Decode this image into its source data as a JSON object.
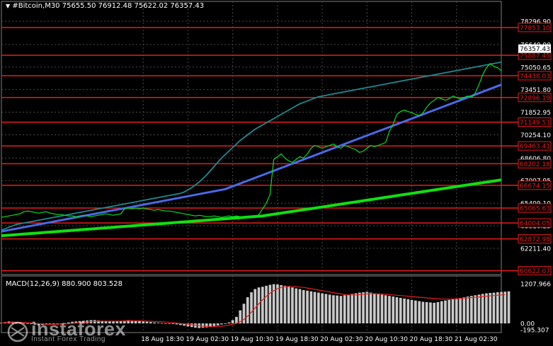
{
  "header": {
    "symbol": "#Bitcoin,M30",
    "ohlc": "75655.50 76912.48 75622.02 76357.43"
  },
  "macd_header": "MACD(12,26,9) 880.900 803.528",
  "watermark": {
    "brand": "instaforex",
    "tagline": "Instant Forex Trading"
  },
  "colors": {
    "background": "#000000",
    "grid": "#4a4a4a",
    "levels": "#e81b1b",
    "price": "#00e020",
    "ma_fast": "#1f8a8e",
    "ma_mid": "#4a6ae8",
    "ma_slow": "#10e010",
    "macd_hist": "#c8c8c8",
    "macd_signal": "#e02020"
  },
  "chart_data": [
    {
      "type": "line",
      "title": "",
      "y_axis_ticks": [
        "78296.90",
        "76649.90",
        "75050.65",
        "73451.80",
        "71852.95",
        "70254.10",
        "68606.80",
        "67007.95",
        "65409.10",
        "63810.25",
        "62211.40"
      ],
      "y_axis_tick_values": [
        78296.9,
        76649.9,
        75050.65,
        73451.8,
        71852.95,
        70254.1,
        68606.8,
        67007.95,
        65409.1,
        63810.25,
        62211.4
      ],
      "ylim": [
        60350,
        78900
      ],
      "current_price": {
        "value": 76357.43,
        "label": "76357.43"
      },
      "level_lines": [
        {
          "value": 77853.1,
          "label": "77853.10"
        },
        {
          "value": 75887.45,
          "label": "75887.45"
        },
        {
          "value": 74438.03,
          "label": "74438.03"
        },
        {
          "value": 72896.19,
          "label": "72896.19"
        },
        {
          "value": 71149.53,
          "label": "71149.53"
        },
        {
          "value": 69463.41,
          "label": "69463.41"
        },
        {
          "value": 68202.18,
          "label": "68202.18"
        },
        {
          "value": 66674.15,
          "label": "66674.15"
        },
        {
          "value": 65065.63,
          "label": "65065.63"
        },
        {
          "value": 64004.05,
          "label": "64004.05"
        },
        {
          "value": 62872.98,
          "label": "62872.98"
        },
        {
          "value": 60622.07,
          "label": "60622.07"
        }
      ],
      "x_tick_labels": [
        "18 Aug 18:30",
        "19 Aug 02:30",
        "19 Aug 10:30",
        "19 Aug 18:30",
        "20 Aug 02:30",
        "20 Aug 10:30",
        "20 Aug 18:30",
        "21 Aug 02:30"
      ],
      "x_tick_index": [
        38,
        50,
        62,
        74,
        86,
        98,
        110,
        122
      ],
      "x_count": 135,
      "series": [
        {
          "role": "price",
          "values": [
            64400,
            64450,
            64500,
            64550,
            64600,
            64650,
            64800,
            64850,
            64800,
            64750,
            64700,
            64750,
            64800,
            64700,
            64650,
            64600,
            64600,
            64550,
            64500,
            64500,
            64450,
            64500,
            64550,
            64500,
            64450,
            64500,
            64550,
            64600,
            64650,
            64600,
            64550,
            64600,
            64650,
            65000,
            65050,
            65000,
            65050,
            65000,
            65050,
            65000,
            64950,
            64900,
            64950,
            64900,
            64850,
            64850,
            64800,
            64750,
            64700,
            64650,
            64600,
            64550,
            64500,
            64550,
            64500,
            64450,
            64450,
            64500,
            64450,
            64400,
            64450,
            64500,
            64450,
            64500,
            64450,
            64400,
            64350,
            64400,
            64400,
            64600,
            65000,
            65400,
            66000,
            68500,
            68700,
            68900,
            68600,
            68400,
            68300,
            68500,
            68700,
            68600,
            68900,
            69300,
            69500,
            69400,
            69300,
            69400,
            69500,
            69600,
            69400,
            69300,
            69500,
            69400,
            69300,
            69200,
            69000,
            69100,
            69300,
            69500,
            69400,
            69500,
            69600,
            69700,
            70500,
            71000,
            71700,
            71900,
            72000,
            71900,
            71800,
            71700,
            71600,
            71800,
            72200,
            72500,
            72700,
            72900,
            72800,
            72700,
            72800,
            73000,
            72900,
            72800,
            72900,
            73000,
            72900,
            73200,
            73800,
            74500,
            75000,
            75300,
            75100,
            75000,
            74800
          ]
        },
        {
          "role": "ma_fast",
          "values": [
            63500,
            63600,
            63700,
            63800,
            63900,
            63950,
            64000,
            64050,
            64100,
            64150,
            64200,
            64250,
            64300,
            64350,
            64400,
            64450,
            64500,
            64550,
            64600,
            64650,
            64700,
            64750,
            64800,
            64850,
            64900,
            64950,
            65000,
            65050,
            65100,
            65150,
            65200,
            65250,
            65300,
            65350,
            65400,
            65450,
            65500,
            65550,
            65600,
            65650,
            65700,
            65750,
            65800,
            65850,
            65900,
            65950,
            66000,
            66050,
            66100,
            66200,
            66350,
            66500,
            66700,
            66900,
            67150,
            67400,
            67700,
            68000,
            68300,
            68600,
            68850,
            69100,
            69350,
            69600,
            69850,
            70050,
            70250,
            70450,
            70650,
            70800,
            70950,
            71100,
            71250,
            71400,
            71550,
            71700,
            71850,
            72000,
            72150,
            72300,
            72450,
            72550,
            72650,
            72750,
            72850,
            72950,
            73000,
            73050,
            73100,
            73150,
            73200,
            73250,
            73300,
            73350,
            73400,
            73450,
            73500,
            73550,
            73600,
            73650,
            73700,
            73750,
            73800,
            73850,
            73900,
            73950,
            74000,
            74050,
            74100,
            74150,
            74200,
            74250,
            74300,
            74350,
            74400,
            74450,
            74500,
            74550,
            74600,
            74650,
            74700,
            74750,
            74800,
            74850,
            74900,
            74950,
            75000,
            75050,
            75100,
            75150,
            75200,
            75250,
            75300,
            75350,
            75400
          ]
        },
        {
          "role": "ma_mid",
          "values": [
            63400,
            63450,
            63500,
            63550,
            63600,
            63650,
            63700,
            63750,
            63800,
            63850,
            63900,
            63950,
            64000,
            64050,
            64100,
            64150,
            64200,
            64250,
            64300,
            64350,
            64400,
            64450,
            64500,
            64550,
            64600,
            64650,
            64700,
            64750,
            64800,
            64850,
            64900,
            64950,
            65000,
            65050,
            65100,
            65150,
            65200,
            65250,
            65300,
            65350,
            65400,
            65450,
            65500,
            65550,
            65600,
            65650,
            65700,
            65750,
            65800,
            65850,
            65900,
            65950,
            66000,
            66050,
            66100,
            66150,
            66200,
            66250,
            66300,
            66350,
            66400,
            66500,
            66600,
            66700,
            66800,
            66900,
            67000,
            67100,
            67200,
            67300,
            67400,
            67500,
            67600,
            67700,
            67800,
            67900,
            68000,
            68100,
            68200,
            68300,
            68400,
            68500,
            68600,
            68700,
            68800,
            68900,
            69000,
            69100,
            69200,
            69300,
            69400,
            69500,
            69600,
            69700,
            69800,
            69900,
            70000,
            70100,
            70200,
            70300,
            70400,
            70500,
            70600,
            70700,
            70800,
            70900,
            71000,
            71100,
            71200,
            71300,
            71400,
            71500,
            71600,
            71700,
            71800,
            71900,
            72000,
            72100,
            72200,
            72300,
            72400,
            72500,
            72600,
            72700,
            72800,
            72900,
            73000,
            73100,
            73200,
            73300,
            73400,
            73500,
            73600,
            73700,
            73800
          ]
        },
        {
          "role": "ma_slow",
          "values": [
            63100,
            63120,
            63140,
            63160,
            63180,
            63200,
            63220,
            63240,
            63260,
            63280,
            63300,
            63320,
            63340,
            63360,
            63380,
            63400,
            63420,
            63440,
            63460,
            63480,
            63500,
            63520,
            63540,
            63560,
            63580,
            63600,
            63620,
            63640,
            63660,
            63680,
            63700,
            63720,
            63740,
            63760,
            63780,
            63800,
            63820,
            63840,
            63860,
            63880,
            63900,
            63920,
            63940,
            63960,
            63980,
            64000,
            64020,
            64040,
            64060,
            64080,
            64100,
            64120,
            64140,
            64160,
            64180,
            64200,
            64220,
            64240,
            64260,
            64280,
            64300,
            64320,
            64340,
            64360,
            64380,
            64400,
            64420,
            64440,
            64460,
            64480,
            64500,
            64540,
            64580,
            64620,
            64660,
            64700,
            64740,
            64780,
            64820,
            64860,
            64900,
            64940,
            64980,
            65020,
            65060,
            65100,
            65140,
            65180,
            65220,
            65260,
            65300,
            65340,
            65380,
            65420,
            65460,
            65500,
            65540,
            65580,
            65620,
            65660,
            65700,
            65740,
            65780,
            65820,
            65860,
            65900,
            65940,
            65980,
            66020,
            66060,
            66100,
            66140,
            66180,
            66220,
            66260,
            66300,
            66340,
            66380,
            66420,
            66460,
            66500,
            66540,
            66580,
            66620,
            66660,
            66700,
            66740,
            66780,
            66820,
            66860,
            66900,
            66940,
            66980,
            67020,
            67060
          ]
        }
      ]
    },
    {
      "type": "bar",
      "title": "MACD(12,26,9) 880.900 803.528",
      "y_axis_ticks": [
        "1207.966",
        "0.00",
        "-195.307"
      ],
      "y_axis_tick_values": [
        1207.966,
        0,
        -195.307
      ],
      "ylim": [
        -280,
        1320
      ],
      "series": [
        {
          "role": "histogram",
          "values": [
            20,
            40,
            60,
            50,
            30,
            20,
            10,
            0,
            -20,
            -40,
            -60,
            -50,
            -40,
            -30,
            -20,
            -10,
            0,
            10,
            30,
            50,
            60,
            70,
            80,
            90,
            100,
            100,
            90,
            80,
            70,
            60,
            60,
            70,
            80,
            90,
            100,
            90,
            80,
            70,
            60,
            50,
            40,
            30,
            20,
            10,
            0,
            -10,
            -20,
            -30,
            -50,
            -70,
            -90,
            -110,
            -130,
            -140,
            -130,
            -120,
            -100,
            -80,
            -60,
            -30,
            0,
            30,
            100,
            200,
            400,
            600,
            800,
            950,
            1050,
            1100,
            1120,
            1150,
            1180,
            1200,
            1190,
            1170,
            1150,
            1120,
            1100,
            1070,
            1050,
            1020,
            1000,
            980,
            960,
            940,
            920,
            900,
            880,
            860,
            850,
            840,
            860,
            880,
            900,
            920,
            940,
            950,
            960,
            940,
            920,
            900,
            880,
            860,
            840,
            820,
            800,
            780,
            760,
            740,
            720,
            700,
            680,
            660,
            650,
            640,
            630,
            650,
            680,
            700,
            720,
            740,
            760,
            780,
            800,
            820,
            840,
            860,
            880,
            900,
            920,
            930,
            940,
            950,
            960,
            970,
            980
          ]
        },
        {
          "role": "signal",
          "values": [
            10,
            20,
            30,
            35,
            35,
            33,
            30,
            25,
            15,
            5,
            -5,
            -15,
            -25,
            -30,
            -30,
            -28,
            -25,
            -20,
            -10,
            0,
            10,
            20,
            30,
            40,
            50,
            60,
            65,
            70,
            70,
            70,
            70,
            70,
            72,
            75,
            78,
            80,
            80,
            78,
            75,
            70,
            65,
            60,
            55,
            50,
            40,
            30,
            20,
            10,
            0,
            -10,
            -25,
            -40,
            -55,
            -70,
            -85,
            -95,
            -100,
            -100,
            -95,
            -85,
            -70,
            -50,
            -30,
            0,
            50,
            120,
            220,
            340,
            470,
            600,
            720,
            830,
            920,
            1000,
            1060,
            1100,
            1120,
            1130,
            1130,
            1120,
            1110,
            1100,
            1080,
            1060,
            1040,
            1020,
            1000,
            980,
            960,
            940,
            920,
            900,
            880,
            870,
            870,
            870,
            880,
            890,
            900,
            905,
            905,
            900,
            895,
            890,
            880,
            870,
            860,
            850,
            840,
            830,
            820,
            810,
            800,
            790,
            780,
            770,
            760,
            750,
            745,
            740,
            740,
            745,
            750,
            760,
            770,
            780,
            790,
            800,
            810,
            820,
            830,
            840,
            850,
            860,
            870,
            880
          ]
        }
      ]
    }
  ]
}
